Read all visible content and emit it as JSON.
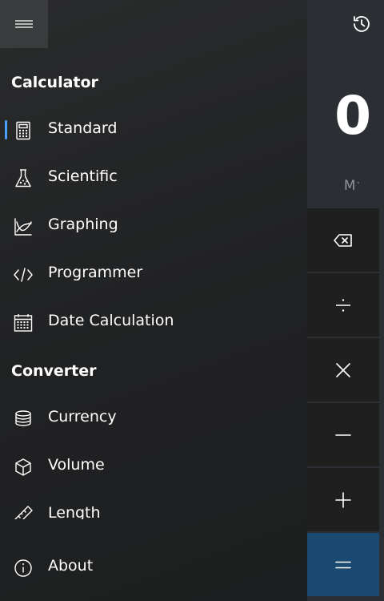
{
  "calculator": {
    "display_value": "0",
    "memory_label": "M",
    "memory_chevron": "˅",
    "ops": [
      {
        "name": "backspace",
        "symbol": "⌫"
      },
      {
        "name": "divide",
        "symbol": "÷"
      },
      {
        "name": "multiply",
        "symbol": "×"
      },
      {
        "name": "subtract",
        "symbol": "—"
      },
      {
        "name": "add",
        "symbol": "+"
      },
      {
        "name": "equals",
        "symbol": "="
      }
    ]
  },
  "drawer": {
    "calculator_header": "Calculator",
    "converter_header": "Converter",
    "calculator_items": [
      {
        "label": "Standard",
        "icon": "calculator-icon",
        "selected": true
      },
      {
        "label": "Scientific",
        "icon": "flask-icon"
      },
      {
        "label": "Graphing",
        "icon": "graph-icon"
      },
      {
        "label": "Programmer",
        "icon": "code-icon"
      },
      {
        "label": "Date Calculation",
        "icon": "calendar-icon"
      }
    ],
    "converter_items": [
      {
        "label": "Currency",
        "icon": "coins-icon"
      },
      {
        "label": "Volume",
        "icon": "cube-icon"
      },
      {
        "label": "Length",
        "icon": "ruler-icon"
      }
    ],
    "about": {
      "label": "About",
      "icon": "info-icon"
    }
  },
  "colors": {
    "accent": "#4aa0ff",
    "equals_bg": "#1a4a72",
    "drawer_bg": "#212223",
    "op_bg": "#1f1f1f"
  }
}
